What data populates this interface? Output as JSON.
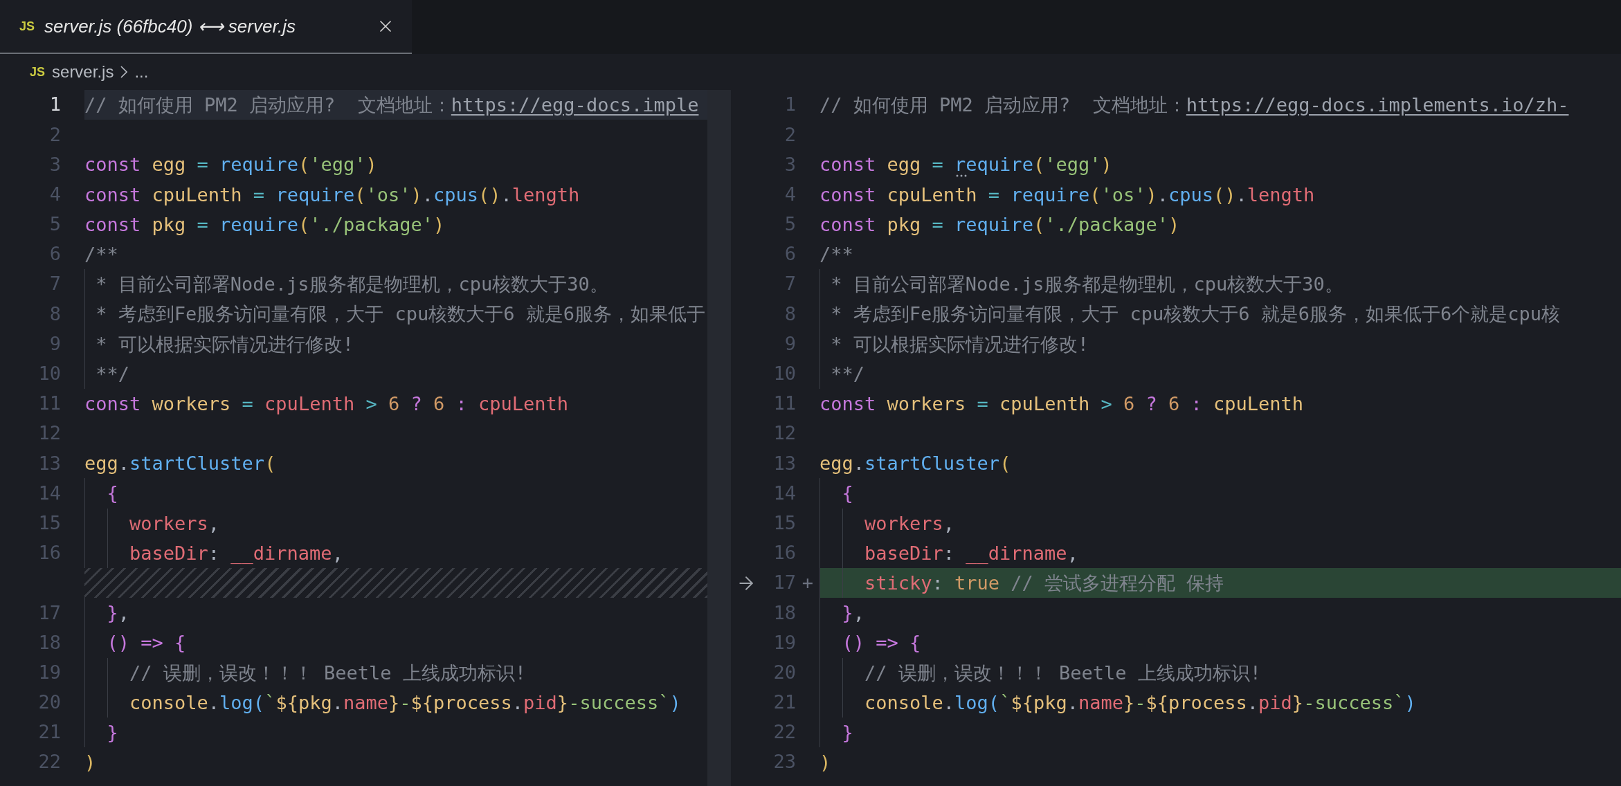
{
  "tab": {
    "icon_text": "JS",
    "title": "server.js (66fbc40) ⟷ server.js",
    "selected": true
  },
  "breadcrumb": {
    "icon_text": "JS",
    "file": "server.js",
    "rest": "..."
  },
  "panes": [
    {
      "lines": [
        {
          "number": "1",
          "kind": "normal",
          "current": true,
          "tokens": [
            {
              "text": "// 如何使用 PM2 启动应用?  文档地址：",
              "kind": "comment"
            },
            {
              "text": "https://egg-docs.imple",
              "kind": "link"
            }
          ]
        },
        {
          "number": "2",
          "kind": "normal",
          "current": false
        },
        {
          "number": "3",
          "kind": "normal",
          "current": false,
          "tokens": [
            {
              "text": "const ",
              "kind": "keyword"
            },
            {
              "text": "egg ",
              "kind": "variable"
            },
            {
              "text": "= ",
              "kind": "operator"
            },
            {
              "text": "require",
              "kind": "function"
            },
            {
              "text": "(",
              "kind": "bracket"
            },
            {
              "text": "'egg'",
              "kind": "string"
            },
            {
              "text": ")",
              "kind": "bracket"
            }
          ]
        },
        {
          "number": "4",
          "kind": "normal",
          "current": false,
          "tokens": [
            {
              "text": "const ",
              "kind": "keyword"
            },
            {
              "text": "cpuLenth ",
              "kind": "variable"
            },
            {
              "text": "= ",
              "kind": "operator"
            },
            {
              "text": "require",
              "kind": "function"
            },
            {
              "text": "(",
              "kind": "bracket"
            },
            {
              "text": "'os'",
              "kind": "string"
            },
            {
              "text": ")",
              "kind": "bracket"
            },
            {
              "text": ".",
              "kind": "plain"
            },
            {
              "text": "cpus",
              "kind": "function"
            },
            {
              "text": "()",
              "kind": "bracket"
            },
            {
              "text": ".",
              "kind": "plain"
            },
            {
              "text": "length",
              "kind": "property"
            }
          ]
        },
        {
          "number": "5",
          "kind": "normal",
          "current": false,
          "tokens": [
            {
              "text": "const ",
              "kind": "keyword"
            },
            {
              "text": "pkg ",
              "kind": "variable"
            },
            {
              "text": "= ",
              "kind": "operator"
            },
            {
              "text": "require",
              "kind": "function"
            },
            {
              "text": "(",
              "kind": "bracket"
            },
            {
              "text": "'./package'",
              "kind": "string"
            },
            {
              "text": ")",
              "kind": "bracket"
            }
          ]
        },
        {
          "number": "6",
          "kind": "normal",
          "current": false,
          "tokens": [
            {
              "text": "/**",
              "kind": "comment"
            }
          ]
        },
        {
          "number": "7",
          "kind": "normal",
          "current": false,
          "tokens": [
            {
              "text": " * 目前公司部署Node.js服务都是物理机，cpu核数大于30。",
              "kind": "comment"
            }
          ]
        },
        {
          "number": "8",
          "kind": "normal",
          "current": false,
          "tokens": [
            {
              "text": " * 考虑到Fe服务访问量有限，大于 cpu核数大于6 就是6服务，如果低于",
              "kind": "comment"
            }
          ]
        },
        {
          "number": "9",
          "kind": "normal",
          "current": false,
          "tokens": [
            {
              "text": " * 可以根据实际情况进行修改!",
              "kind": "comment"
            }
          ]
        },
        {
          "number": "10",
          "kind": "normal",
          "current": false,
          "tokens": [
            {
              "text": " **/",
              "kind": "comment"
            }
          ]
        },
        {
          "number": "11",
          "kind": "normal",
          "current": false,
          "tokens": [
            {
              "text": "const ",
              "kind": "keyword"
            },
            {
              "text": "workers ",
              "kind": "variable"
            },
            {
              "text": "= ",
              "kind": "operator"
            },
            {
              "text": "cpuLenth ",
              "kind": "property"
            },
            {
              "text": "> ",
              "kind": "operator"
            },
            {
              "text": "6 ",
              "kind": "number"
            },
            {
              "text": "? ",
              "kind": "keyword"
            },
            {
              "text": "6 ",
              "kind": "number"
            },
            {
              "text": ": ",
              "kind": "keyword"
            },
            {
              "text": "cpuLenth",
              "kind": "property"
            }
          ]
        },
        {
          "number": "12",
          "kind": "normal",
          "current": false
        },
        {
          "number": "13",
          "kind": "normal",
          "current": false,
          "tokens": [
            {
              "text": "egg",
              "kind": "variable"
            },
            {
              "text": ".",
              "kind": "plain"
            },
            {
              "text": "startCluster",
              "kind": "function"
            },
            {
              "text": "(",
              "kind": "bracket"
            }
          ]
        },
        {
          "number": "14",
          "kind": "normal",
          "current": false,
          "tokens": [
            {
              "text": "  {",
              "kind": "bracket2"
            }
          ]
        },
        {
          "number": "15",
          "kind": "normal",
          "current": false,
          "tokens": [
            {
              "text": "    workers",
              "kind": "property"
            },
            {
              "text": ",",
              "kind": "plain"
            }
          ]
        },
        {
          "number": "16",
          "kind": "normal",
          "current": false,
          "tokens": [
            {
              "text": "    baseDir",
              "kind": "property"
            },
            {
              "text": ": ",
              "kind": "plain"
            },
            {
              "text": "__dirname",
              "kind": "property"
            },
            {
              "text": ",",
              "kind": "plain"
            }
          ]
        },
        {
          "kind": "placeholder",
          "current": false
        },
        {
          "number": "17",
          "kind": "normal",
          "current": false,
          "tokens": [
            {
              "text": "  }",
              "kind": "bracket2"
            },
            {
              "text": ",",
              "kind": "plain"
            }
          ]
        },
        {
          "number": "18",
          "kind": "normal",
          "current": false,
          "tokens": [
            {
              "text": "  () ",
              "kind": "bracket2"
            },
            {
              "text": "=> ",
              "kind": "keyword"
            },
            {
              "text": "{",
              "kind": "bracket2"
            }
          ]
        },
        {
          "number": "19",
          "kind": "normal",
          "current": false,
          "tokens": [
            {
              "text": "    // 误删，误改！！！ Beetle 上线成功标识!",
              "kind": "comment"
            }
          ]
        },
        {
          "number": "20",
          "kind": "normal",
          "current": false,
          "tokens": [
            {
              "text": "    console",
              "kind": "variable"
            },
            {
              "text": ".",
              "kind": "plain"
            },
            {
              "text": "log",
              "kind": "function"
            },
            {
              "text": "(",
              "kind": "bracket3"
            },
            {
              "text": "`",
              "kind": "string"
            },
            {
              "text": "${pkg",
              "kind": "variable"
            },
            {
              "text": ".",
              "kind": "plain"
            },
            {
              "text": "name",
              "kind": "property"
            },
            {
              "text": "}",
              "kind": "variable"
            },
            {
              "text": "-",
              "kind": "string"
            },
            {
              "text": "${process",
              "kind": "variable"
            },
            {
              "text": ".",
              "kind": "plain"
            },
            {
              "text": "pid",
              "kind": "property"
            },
            {
              "text": "}",
              "kind": "variable"
            },
            {
              "text": "-success`",
              "kind": "string"
            },
            {
              "text": ")",
              "kind": "bracket3"
            }
          ]
        },
        {
          "number": "21",
          "kind": "normal",
          "current": false,
          "tokens": [
            {
              "text": "  }",
              "kind": "bracket2"
            }
          ]
        },
        {
          "number": "22",
          "kind": "normal",
          "current": false,
          "tokens": [
            {
              "text": ")",
              "kind": "bracket"
            }
          ]
        }
      ]
    },
    {
      "lines": [
        {
          "number": "1",
          "kind": "normal",
          "current": false,
          "tokens": [
            {
              "text": "// 如何使用 PM2 启动应用?  文档地址：",
              "kind": "comment"
            },
            {
              "text": "https://egg-docs.implements.io/zh-",
              "kind": "link"
            }
          ]
        },
        {
          "number": "2",
          "kind": "normal",
          "current": false
        },
        {
          "number": "3",
          "kind": "normal",
          "current": false,
          "tokens": [
            {
              "text": "const ",
              "kind": "keyword"
            },
            {
              "text": "egg ",
              "kind": "variable"
            },
            {
              "text": "= ",
              "kind": "operator"
            },
            {
              "text": "require",
              "kind": "function",
              "hint": true
            },
            {
              "text": "(",
              "kind": "bracket"
            },
            {
              "text": "'egg'",
              "kind": "string"
            },
            {
              "text": ")",
              "kind": "bracket"
            }
          ]
        },
        {
          "number": "4",
          "kind": "normal",
          "current": false,
          "tokens": [
            {
              "text": "const ",
              "kind": "keyword"
            },
            {
              "text": "cpuLenth ",
              "kind": "variable"
            },
            {
              "text": "= ",
              "kind": "operator"
            },
            {
              "text": "require",
              "kind": "function"
            },
            {
              "text": "(",
              "kind": "bracket"
            },
            {
              "text": "'os'",
              "kind": "string"
            },
            {
              "text": ")",
              "kind": "bracket"
            },
            {
              "text": ".",
              "kind": "plain"
            },
            {
              "text": "cpus",
              "kind": "function"
            },
            {
              "text": "()",
              "kind": "bracket"
            },
            {
              "text": ".",
              "kind": "plain"
            },
            {
              "text": "length",
              "kind": "property"
            }
          ]
        },
        {
          "number": "5",
          "kind": "normal",
          "current": false,
          "tokens": [
            {
              "text": "const ",
              "kind": "keyword"
            },
            {
              "text": "pkg ",
              "kind": "variable"
            },
            {
              "text": "= ",
              "kind": "operator"
            },
            {
              "text": "require",
              "kind": "function"
            },
            {
              "text": "(",
              "kind": "bracket"
            },
            {
              "text": "'./package'",
              "kind": "string"
            },
            {
              "text": ")",
              "kind": "bracket"
            }
          ]
        },
        {
          "number": "6",
          "kind": "normal",
          "current": false,
          "tokens": [
            {
              "text": "/**",
              "kind": "comment"
            }
          ]
        },
        {
          "number": "7",
          "kind": "normal",
          "current": false,
          "tokens": [
            {
              "text": " * 目前公司部署Node.js服务都是物理机，cpu核数大于30。",
              "kind": "comment"
            }
          ]
        },
        {
          "number": "8",
          "kind": "normal",
          "current": false,
          "tokens": [
            {
              "text": " * 考虑到Fe服务访问量有限，大于 cpu核数大于6 就是6服务，如果低于6个就是cpu核",
              "kind": "comment"
            }
          ]
        },
        {
          "number": "9",
          "kind": "normal",
          "current": false,
          "tokens": [
            {
              "text": " * 可以根据实际情况进行修改!",
              "kind": "comment"
            }
          ]
        },
        {
          "number": "10",
          "kind": "normal",
          "current": false,
          "tokens": [
            {
              "text": " **/",
              "kind": "comment"
            }
          ]
        },
        {
          "number": "11",
          "kind": "normal",
          "current": false,
          "tokens": [
            {
              "text": "const ",
              "kind": "keyword"
            },
            {
              "text": "workers ",
              "kind": "variable"
            },
            {
              "text": "= ",
              "kind": "operator"
            },
            {
              "text": "cpuLenth ",
              "kind": "variable"
            },
            {
              "text": "> ",
              "kind": "operator"
            },
            {
              "text": "6 ",
              "kind": "number"
            },
            {
              "text": "? ",
              "kind": "keyword"
            },
            {
              "text": "6 ",
              "kind": "number"
            },
            {
              "text": ": ",
              "kind": "keyword"
            },
            {
              "text": "cpuLenth",
              "kind": "variable"
            }
          ]
        },
        {
          "number": "12",
          "kind": "normal",
          "current": false
        },
        {
          "number": "13",
          "kind": "normal",
          "current": false,
          "tokens": [
            {
              "text": "egg",
              "kind": "variable"
            },
            {
              "text": ".",
              "kind": "plain"
            },
            {
              "text": "startCluster",
              "kind": "function"
            },
            {
              "text": "(",
              "kind": "bracket"
            }
          ]
        },
        {
          "number": "14",
          "kind": "normal",
          "current": false,
          "tokens": [
            {
              "text": "  {",
              "kind": "bracket2"
            }
          ]
        },
        {
          "number": "15",
          "kind": "normal",
          "current": false,
          "tokens": [
            {
              "text": "    workers",
              "kind": "property"
            },
            {
              "text": ",",
              "kind": "plain"
            }
          ]
        },
        {
          "number": "16",
          "kind": "normal",
          "current": false,
          "tokens": [
            {
              "text": "    baseDir",
              "kind": "property"
            },
            {
              "text": ": ",
              "kind": "plain"
            },
            {
              "text": "__dirname",
              "kind": "property"
            },
            {
              "text": ",",
              "kind": "plain"
            }
          ]
        },
        {
          "number": "17",
          "kind": "added",
          "marker": "+",
          "current": false,
          "tokens": [
            {
              "text": "    sticky",
              "kind": "property"
            },
            {
              "text": ": ",
              "kind": "plain"
            },
            {
              "text": "true ",
              "kind": "number"
            },
            {
              "text": "// 尝试多进程分配 保持",
              "kind": "comment"
            }
          ]
        },
        {
          "number": "18",
          "kind": "normal",
          "current": false,
          "tokens": [
            {
              "text": "  }",
              "kind": "bracket2"
            },
            {
              "text": ",",
              "kind": "plain"
            }
          ]
        },
        {
          "number": "19",
          "kind": "normal",
          "current": false,
          "tokens": [
            {
              "text": "  () ",
              "kind": "bracket2"
            },
            {
              "text": "=> ",
              "kind": "keyword"
            },
            {
              "text": "{",
              "kind": "bracket2"
            }
          ]
        },
        {
          "number": "20",
          "kind": "normal",
          "current": false,
          "tokens": [
            {
              "text": "    // 误删，误改！！！ Beetle 上线成功标识!",
              "kind": "comment"
            }
          ]
        },
        {
          "number": "21",
          "kind": "normal",
          "current": false,
          "tokens": [
            {
              "text": "    console",
              "kind": "variable"
            },
            {
              "text": ".",
              "kind": "plain"
            },
            {
              "text": "log",
              "kind": "function"
            },
            {
              "text": "(",
              "kind": "bracket3"
            },
            {
              "text": "`",
              "kind": "string"
            },
            {
              "text": "${pkg",
              "kind": "variable"
            },
            {
              "text": ".",
              "kind": "plain"
            },
            {
              "text": "name",
              "kind": "property"
            },
            {
              "text": "}",
              "kind": "variable"
            },
            {
              "text": "-",
              "kind": "string"
            },
            {
              "text": "${process",
              "kind": "variable"
            },
            {
              "text": ".",
              "kind": "plain"
            },
            {
              "text": "pid",
              "kind": "property"
            },
            {
              "text": "}",
              "kind": "variable"
            },
            {
              "text": "-success`",
              "kind": "string"
            },
            {
              "text": ")",
              "kind": "bracket3"
            }
          ]
        },
        {
          "number": "22",
          "kind": "normal",
          "current": false,
          "tokens": [
            {
              "text": "  }",
              "kind": "bracket2"
            }
          ]
        },
        {
          "number": "23",
          "kind": "normal",
          "current": false,
          "tokens": [
            {
              "text": ")",
              "kind": "bracket"
            }
          ]
        }
      ]
    }
  ]
}
